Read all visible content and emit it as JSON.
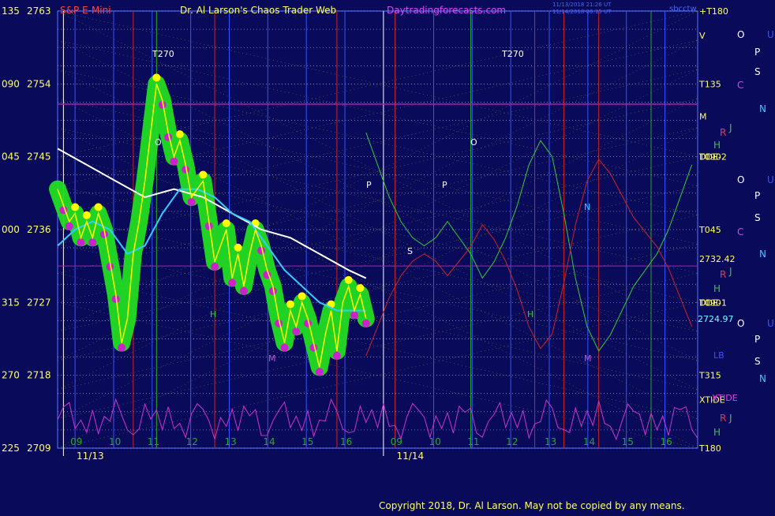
{
  "header": {
    "instrument": "S&P E-Mini",
    "site": "Dr. Al Larson's Chaos Trader Web",
    "url": "Daytradingforecasts.com",
    "timestamp1": "11/13/2018 21:26 UT",
    "timestamp2": "11/14/2018 00:15 UT",
    "corner": "sbcctw"
  },
  "footer": {
    "copyright": "Copyright 2018, Dr. Al Larson. May not be copied by any means."
  },
  "colors": {
    "background": "#0a0a5a",
    "price": "#ffff00",
    "glow": "#22dd22",
    "magenta": "#cc22cc",
    "ma_fast": "#33ccff",
    "ma_slow": "#ffffff",
    "grid_v": "#3355ff",
    "red_v": "#cc2222",
    "green_v": "#22aa22"
  },
  "chart_data": {
    "type": "line",
    "title": "S&P E-Mini",
    "ylim": [
      2709,
      2763
    ],
    "y_ticks": [
      {
        "angle": "135",
        "price": 2763
      },
      {
        "angle": "090",
        "price": 2754
      },
      {
        "angle": "045",
        "price": 2745
      },
      {
        "angle": "000",
        "price": 2736
      },
      {
        "angle": "315",
        "price": 2727
      },
      {
        "angle": "270",
        "price": 2718
      },
      {
        "angle": "225",
        "price": 2709
      }
    ],
    "x_hours_day1": [
      "09",
      "10",
      "11",
      "12",
      "13",
      "14",
      "15",
      "16"
    ],
    "x_hours_day2": [
      "09",
      "10",
      "11",
      "12",
      "13",
      "14",
      "15",
      "16"
    ],
    "dates": [
      "11/13",
      "11/14"
    ],
    "last_price_label": "2732.42",
    "lower_price_label": "2724.97",
    "series": [
      {
        "name": "price",
        "x": [
          0,
          2,
          4,
          6,
          8,
          10,
          12,
          14,
          16,
          18,
          20,
          22,
          24,
          26,
          28,
          30,
          32,
          34,
          36,
          38,
          40,
          42,
          44,
          46,
          48,
          50,
          52,
          54,
          56,
          58,
          60,
          62,
          64,
          66,
          68,
          70,
          72,
          74,
          76,
          78,
          80,
          82,
          84,
          86,
          88,
          90,
          92,
          94,
          96,
          98,
          100,
          102,
          104,
          106
        ],
        "y": [
          2741,
          2739,
          2737,
          2738,
          2735,
          2737,
          2735,
          2738,
          2736,
          2732,
          2728,
          2722,
          2725,
          2733,
          2737,
          2742,
          2748,
          2754,
          2752,
          2748,
          2745,
          2747,
          2744,
          2740,
          2741,
          2742,
          2737,
          2732,
          2734,
          2736,
          2730,
          2733,
          2729,
          2733,
          2736,
          2734,
          2731,
          2729,
          2725,
          2722,
          2726,
          2724,
          2727,
          2725,
          2722,
          2719,
          2723,
          2726,
          2721,
          2727,
          2729,
          2726,
          2728,
          2725
        ]
      },
      {
        "name": "ma_fast",
        "x": [
          0,
          6,
          12,
          18,
          24,
          30,
          36,
          42,
          48,
          54,
          60,
          66,
          72,
          78,
          84,
          90,
          96,
          102,
          106
        ],
        "y": [
          2734,
          2736,
          2737,
          2736,
          2733,
          2734,
          2738,
          2741,
          2741,
          2740,
          2738,
          2737,
          2734,
          2731,
          2729,
          2727,
          2726,
          2726,
          2726
        ]
      },
      {
        "name": "ma_slow",
        "x": [
          0,
          10,
          20,
          30,
          40,
          50,
          60,
          70,
          80,
          90,
          100,
          106
        ],
        "y": [
          2746,
          2744,
          2742,
          2740,
          2741,
          2740,
          2738,
          2736,
          2735,
          2733,
          2731,
          2730
        ]
      },
      {
        "name": "forecast",
        "x": [
          106,
          110,
          114,
          118,
          122,
          126,
          130,
          134,
          138,
          142,
          146,
          150,
          154,
          158,
          162,
          166,
          170,
          174,
          178,
          182,
          186,
          190,
          194,
          198,
          202,
          206,
          210,
          214,
          218
        ],
        "y": [
          2748,
          2744,
          2740,
          2737,
          2735,
          2734,
          2735,
          2737,
          2735,
          2733,
          2730,
          2732,
          2735,
          2739,
          2744,
          2747,
          2745,
          2738,
          2730,
          2724,
          2721,
          2723,
          2726,
          2729,
          2731,
          2733,
          2736,
          2740,
          2744
        ]
      }
    ],
    "markers_right": [
      "+T180",
      "V",
      "T135",
      "M",
      "T090",
      "DDE-2",
      "T045",
      "2732.42",
      "T090",
      "DDE-1",
      "T315",
      "XTIDE",
      "T180"
    ],
    "legend_letters": [
      "O",
      "P",
      "S",
      "C",
      "N",
      "U",
      "R",
      "J",
      "H"
    ]
  }
}
